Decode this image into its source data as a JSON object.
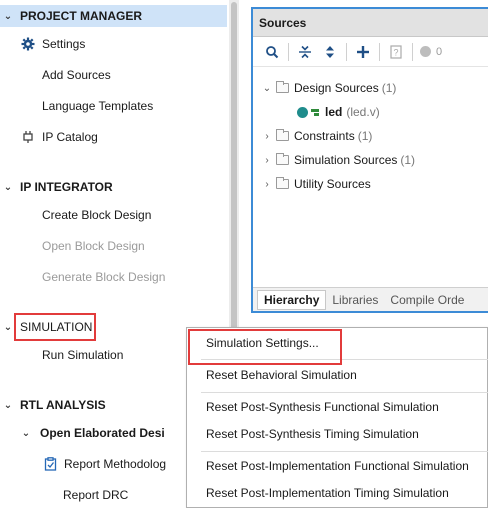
{
  "navigator": {
    "project_manager": {
      "title": "PROJECT MANAGER",
      "items": [
        "Settings",
        "Add Sources",
        "Language Templates",
        "IP Catalog"
      ]
    },
    "ip_integrator": {
      "title": "IP INTEGRATOR",
      "items": [
        "Create Block Design",
        "Open Block Design",
        "Generate Block Design"
      ]
    },
    "simulation": {
      "title": "SIMULATION",
      "items": [
        "Run Simulation"
      ]
    },
    "rtl_analysis": {
      "title": "RTL ANALYSIS",
      "open_elaborated": "Open Elaborated Desi",
      "items": [
        "Report Methodolog",
        "Report DRC"
      ]
    }
  },
  "sources": {
    "title": "Sources",
    "toolbar_count": "0",
    "tree": {
      "design_sources": "Design Sources",
      "design_sources_count": "(1)",
      "led_name": "led",
      "led_file": "(led.v)",
      "constraints": "Constraints",
      "constraints_count": "(1)",
      "simulation_sources": "Simulation Sources",
      "simulation_sources_count": "(1)",
      "utility_sources": "Utility Sources"
    },
    "tabs": [
      "Hierarchy",
      "Libraries",
      "Compile Orde"
    ]
  },
  "context_menu": {
    "items": [
      "Simulation Settings...",
      "Reset Behavioral Simulation",
      "Reset Post-Synthesis Functional Simulation",
      "Reset Post-Synthesis Timing Simulation",
      "Reset Post-Implementation Functional Simulation",
      "Reset Post-Implementation Timing Simulation"
    ]
  },
  "colors": {
    "selection": "#cfe3f8",
    "panel_border": "#3c8bd6",
    "highlight": "#e23b3b",
    "accent_icon": "#2568b6"
  }
}
